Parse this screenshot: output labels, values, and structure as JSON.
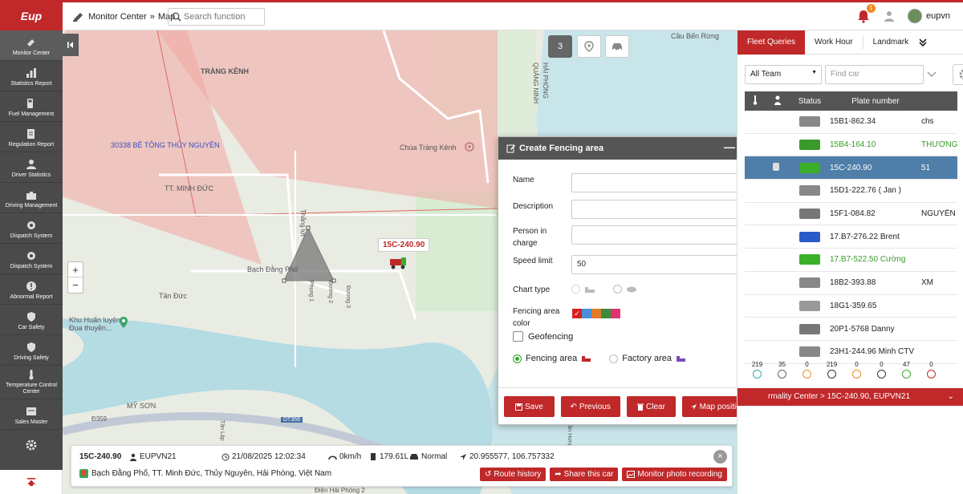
{
  "brand": {
    "logo": "Eup"
  },
  "header": {
    "breadcrumb_current": "Monitor Center",
    "breadcrumb_sep": "»",
    "breadcrumb_page": "Map",
    "search_placeholder": "Search function",
    "notif_count": "1",
    "username": "eupvn"
  },
  "sidebar": {
    "items": [
      {
        "label": "Monitor Center"
      },
      {
        "label": "Statistics Report"
      },
      {
        "label": "Fuel Management"
      },
      {
        "label": "Regulation Report"
      },
      {
        "label": "Driver Statistics"
      },
      {
        "label": "Driving Management"
      },
      {
        "label": "Dispatch System"
      },
      {
        "label": "Dispatch System"
      },
      {
        "label": "Abnormal Report"
      },
      {
        "label": "Car Safety"
      },
      {
        "label": "Driving Safety"
      },
      {
        "label": "Temperature Control Center"
      },
      {
        "label": "Sales Master"
      }
    ]
  },
  "map": {
    "labels": {
      "trang_kenh": "TRÀNG KÊNH",
      "be_tong": "30338 BÊ TÔNG THỦY NGUYÊN",
      "chua": "Chùa Tràng Kênh",
      "minh_duc": "TT. MINH ĐỨC",
      "bach_dang": "Bạch Đằng Phố",
      "tan_duc": "Tân Đức",
      "khu_huan": "Khu Huấn luyện",
      "dua_thuyen": "Đua thuyền...",
      "my_son": "MỸ SƠN",
      "cau_ben_rung": "Cầu Bến Rừng",
      "quang_ninh": "QUẢNG NINH",
      "hai_phong": "HẢI PHÒNG",
      "thang_loi": "Thắng lợi",
      "phung1": "Phụng 1",
      "duong2": "Đường 2",
      "duong3": "Đường 3",
      "dt359": "DT359",
      "d359": "Đ359",
      "dien_hai_phong": "Điện Hải Phòng 2",
      "tan_lap": "Tân Lập",
      "tran_hung": "Trần Hưng Đạo"
    },
    "cluster_count": "3",
    "vehicle_label": "15C-240.90"
  },
  "info": {
    "plate": "15C-240.90",
    "company": "EUPVN21",
    "datetime": "21/08/2025 12:02:34",
    "speed": "0km/h",
    "fuel": "179.61L",
    "status": "Normal",
    "coords": "20.955577, 106.757332",
    "address": "Bạch Đằng Phố, TT. Minh Đức, Thủy Nguyên, Hải Phòng, Việt Nam",
    "btn_route": "Route history",
    "btn_share": "Share this car",
    "btn_photo": "Monitor photo recording"
  },
  "dialog": {
    "title": "Create Fencing area",
    "name_label": "Name",
    "desc_label": "Description",
    "person_label": "Person in charge",
    "speed_label": "Speed limit",
    "speed_value": "50",
    "chart_label": "Chart type",
    "color_label": "Fencing area color",
    "geofencing": "Geofencing",
    "fencing_area": "Fencing area",
    "factory_area": "Factory area",
    "btn_save": "Save",
    "btn_prev": "Previous",
    "btn_clear": "Clear",
    "btn_map": "Map positioning",
    "colors": [
      "#d9201f",
      "#4a90d9",
      "#e07b2a",
      "#3c8a3c",
      "#e0326e"
    ]
  },
  "panel": {
    "tabs": [
      "Fleet Queries",
      "Work Hour",
      "Landmark"
    ],
    "team_select": "All Team",
    "find_placeholder": "Find car",
    "col_status": "Status",
    "col_plate": "Plate number",
    "rows": [
      {
        "plate": "15B1-862.34",
        "extra": "chs",
        "color": "#888"
      },
      {
        "plate": "15B4-164.10",
        "extra": "THƯỜNG",
        "color": "#3a9a2a",
        "green": true
      },
      {
        "plate": "15C-240.90",
        "extra": "51",
        "color": "#3ab02a",
        "selected": true
      },
      {
        "plate": "15D1-222.76 ( Jan )",
        "extra": "",
        "color": "#888"
      },
      {
        "plate": "15F1-084.82",
        "extra": "NGUYỄN",
        "color": "#777"
      },
      {
        "plate": "17.B7-276.22 Brent",
        "extra": "",
        "color": "#2a5ac8"
      },
      {
        "plate": "17.B7-522.50 Cường",
        "extra": "",
        "color": "#3ab02a",
        "green": true
      },
      {
        "plate": "18B2-393.88",
        "extra": "XM",
        "color": "#888"
      },
      {
        "plate": "18G1-359.65",
        "extra": "",
        "color": "#999"
      },
      {
        "plate": "20P1-5768 Danny",
        "extra": "",
        "color": "#777"
      },
      {
        "plate": "23H1-244.96 Minh CTV",
        "extra": "",
        "color": "#888"
      }
    ],
    "stats": [
      "219",
      "35",
      "0",
      "219",
      "0",
      "0",
      "47",
      "0"
    ],
    "alarm": "rmality Center > 15C-240.90, EUPVN21"
  }
}
